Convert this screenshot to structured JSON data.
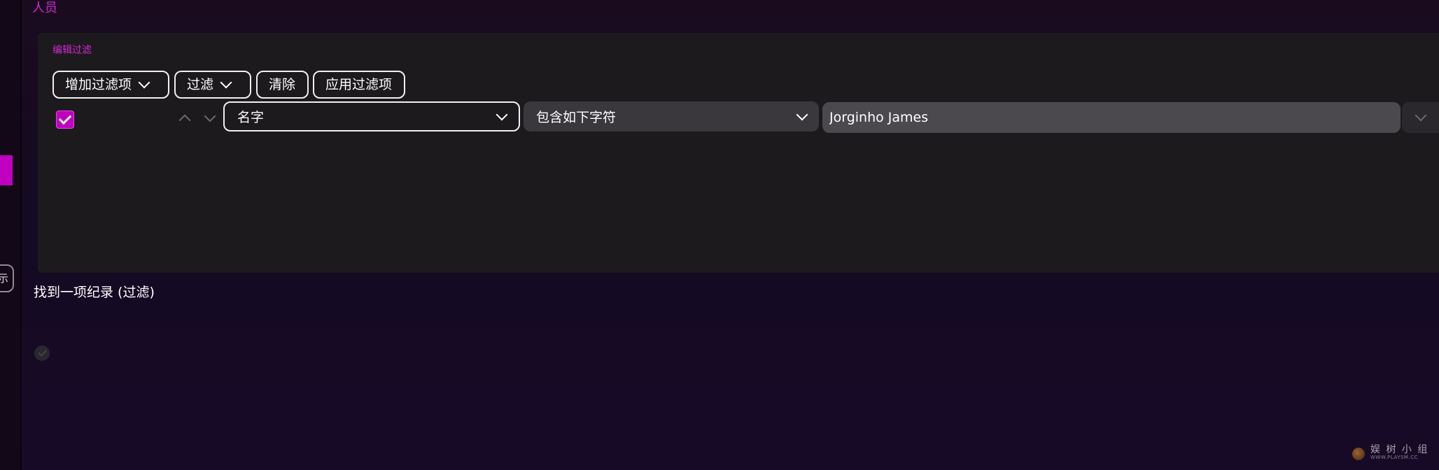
{
  "section": {
    "title": "人员"
  },
  "filter_panel": {
    "label": "编辑过滤",
    "toolbar": {
      "add_filter_label": "增加过滤项",
      "filter_label": "过滤",
      "clear_label": "清除",
      "apply_label": "应用过滤项"
    },
    "row": {
      "enabled": true,
      "field_value": "名字",
      "operator_value": "包含如下字符",
      "value": "Jorginho James"
    }
  },
  "results": {
    "count_text": "找到一项纪录 (过滤)"
  },
  "left_rail": {
    "pill_text": "示"
  },
  "watermark": {
    "main": "娱 树 小 组",
    "sub": "WWW.PLAYSM.CC"
  },
  "colors": {
    "accent": "#c000c0",
    "title_accent": "#d12ad1",
    "panel_bg": "#1c1a1d",
    "page_bg": "#1a0b1f"
  },
  "icons": {
    "add_filter_dropdown": "chevron-down-icon",
    "filter_dropdown": "chevron-down-icon",
    "move_up": "chevron-up-icon",
    "move_down": "chevron-down-icon",
    "field_dropdown": "chevron-down-icon",
    "operator_dropdown": "chevron-down-icon",
    "row_expander": "chevron-down-icon",
    "row_check": "check-icon"
  }
}
